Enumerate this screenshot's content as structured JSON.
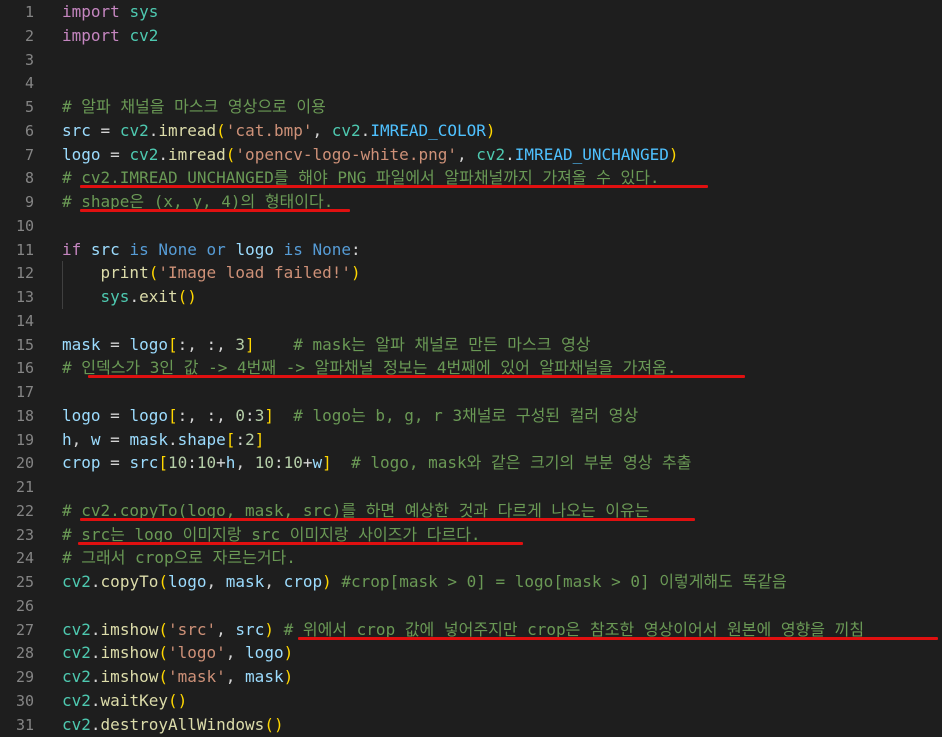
{
  "editor": {
    "language": "python",
    "theme_colors": {
      "background": "#1e1e1e",
      "keyword": "#c586c0",
      "comment": "#6a9955",
      "string": "#ce9178",
      "function": "#dcdcaa",
      "annotation_underline": "#e01010"
    },
    "lines": [
      {
        "n": "1",
        "tokens": [
          {
            "t": "import",
            "c": "kw"
          },
          {
            "t": " "
          },
          {
            "t": "sys",
            "c": "cls"
          }
        ]
      },
      {
        "n": "2",
        "tokens": [
          {
            "t": "import",
            "c": "kw"
          },
          {
            "t": " "
          },
          {
            "t": "cv2",
            "c": "cls"
          }
        ]
      },
      {
        "n": "3",
        "tokens": []
      },
      {
        "n": "4",
        "tokens": []
      },
      {
        "n": "5",
        "tokens": [
          {
            "t": "# 알파 채널을 마스크 영상으로 이용",
            "c": "cmt"
          }
        ]
      },
      {
        "n": "6",
        "tokens": [
          {
            "t": "src",
            "c": "id"
          },
          {
            "t": " = "
          },
          {
            "t": "cv2",
            "c": "cls"
          },
          {
            "t": "."
          },
          {
            "t": "imread",
            "c": "fn"
          },
          {
            "t": "(",
            "c": "p1"
          },
          {
            "t": "'cat.bmp'",
            "c": "str"
          },
          {
            "t": ", "
          },
          {
            "t": "cv2",
            "c": "cls"
          },
          {
            "t": "."
          },
          {
            "t": "IMREAD_COLOR",
            "c": "const"
          },
          {
            "t": ")",
            "c": "p1"
          }
        ]
      },
      {
        "n": "7",
        "tokens": [
          {
            "t": "logo",
            "c": "id"
          },
          {
            "t": " = "
          },
          {
            "t": "cv2",
            "c": "cls"
          },
          {
            "t": "."
          },
          {
            "t": "imread",
            "c": "fn"
          },
          {
            "t": "(",
            "c": "p1"
          },
          {
            "t": "'opencv-logo-white.png'",
            "c": "str"
          },
          {
            "t": ", "
          },
          {
            "t": "cv2",
            "c": "cls"
          },
          {
            "t": "."
          },
          {
            "t": "IMREAD_UNCHANGED",
            "c": "const"
          },
          {
            "t": ")",
            "c": "p1"
          }
        ]
      },
      {
        "n": "8",
        "tokens": [
          {
            "t": "# cv2.IMREAD_UNCHANGED를 해야 PNG 파일에서 알파채널까지 가져올 수 있다.",
            "c": "cmt"
          }
        ]
      },
      {
        "n": "9",
        "tokens": [
          {
            "t": "# shape은 (x, y, 4)의 형태이다.",
            "c": "cmt"
          }
        ]
      },
      {
        "n": "10",
        "tokens": []
      },
      {
        "n": "11",
        "tokens": [
          {
            "t": "if",
            "c": "kw"
          },
          {
            "t": " "
          },
          {
            "t": "src",
            "c": "id"
          },
          {
            "t": " "
          },
          {
            "t": "is",
            "c": "bi"
          },
          {
            "t": " "
          },
          {
            "t": "None",
            "c": "bi"
          },
          {
            "t": " "
          },
          {
            "t": "or",
            "c": "bi"
          },
          {
            "t": " "
          },
          {
            "t": "logo",
            "c": "id"
          },
          {
            "t": " "
          },
          {
            "t": "is",
            "c": "bi"
          },
          {
            "t": " "
          },
          {
            "t": "None",
            "c": "bi"
          },
          {
            "t": ":"
          }
        ]
      },
      {
        "n": "12",
        "indent": true,
        "tokens": [
          {
            "t": "    "
          },
          {
            "t": "print",
            "c": "fn"
          },
          {
            "t": "(",
            "c": "p1"
          },
          {
            "t": "'Image load failed!'",
            "c": "str"
          },
          {
            "t": ")",
            "c": "p1"
          }
        ]
      },
      {
        "n": "13",
        "indent": true,
        "tokens": [
          {
            "t": "    "
          },
          {
            "t": "sys",
            "c": "cls"
          },
          {
            "t": "."
          },
          {
            "t": "exit",
            "c": "fn"
          },
          {
            "t": "()",
            "c": "p1"
          }
        ]
      },
      {
        "n": "14",
        "tokens": []
      },
      {
        "n": "15",
        "tokens": [
          {
            "t": "mask",
            "c": "id"
          },
          {
            "t": " = "
          },
          {
            "t": "logo",
            "c": "id"
          },
          {
            "t": "[",
            "c": "p1"
          },
          {
            "t": ":, :, "
          },
          {
            "t": "3",
            "c": "num"
          },
          {
            "t": "]",
            "c": "p1"
          },
          {
            "t": "    "
          },
          {
            "t": "# mask는 알파 채널로 만든 마스크 영상",
            "c": "cmt"
          }
        ]
      },
      {
        "n": "16",
        "tokens": [
          {
            "t": "# 인덱스가 3인 값 -> 4번째 -> 알파채널 정보는 4번째에 있어 알파채널을 가져옴.",
            "c": "cmt"
          }
        ]
      },
      {
        "n": "17",
        "tokens": []
      },
      {
        "n": "18",
        "tokens": [
          {
            "t": "logo",
            "c": "id"
          },
          {
            "t": " = "
          },
          {
            "t": "logo",
            "c": "id"
          },
          {
            "t": "[",
            "c": "p1"
          },
          {
            "t": ":, :, "
          },
          {
            "t": "0",
            "c": "num"
          },
          {
            "t": ":"
          },
          {
            "t": "3",
            "c": "num"
          },
          {
            "t": "]",
            "c": "p1"
          },
          {
            "t": "  "
          },
          {
            "t": "# logo는 b, g, r 3채널로 구성된 컬러 영상",
            "c": "cmt"
          }
        ]
      },
      {
        "n": "19",
        "tokens": [
          {
            "t": "h",
            "c": "id"
          },
          {
            "t": ", "
          },
          {
            "t": "w",
            "c": "id"
          },
          {
            "t": " = "
          },
          {
            "t": "mask",
            "c": "id"
          },
          {
            "t": "."
          },
          {
            "t": "shape",
            "c": "id"
          },
          {
            "t": "[",
            "c": "p1"
          },
          {
            "t": ":"
          },
          {
            "t": "2",
            "c": "num"
          },
          {
            "t": "]",
            "c": "p1"
          }
        ]
      },
      {
        "n": "20",
        "tokens": [
          {
            "t": "crop",
            "c": "id"
          },
          {
            "t": " = "
          },
          {
            "t": "src",
            "c": "id"
          },
          {
            "t": "[",
            "c": "p1"
          },
          {
            "t": "10",
            "c": "num"
          },
          {
            "t": ":"
          },
          {
            "t": "10",
            "c": "num"
          },
          {
            "t": "+"
          },
          {
            "t": "h",
            "c": "id"
          },
          {
            "t": ", "
          },
          {
            "t": "10",
            "c": "num"
          },
          {
            "t": ":"
          },
          {
            "t": "10",
            "c": "num"
          },
          {
            "t": "+"
          },
          {
            "t": "w",
            "c": "id"
          },
          {
            "t": "]",
            "c": "p1"
          },
          {
            "t": "  "
          },
          {
            "t": "# logo, mask와 같은 크기의 부분 영상 추출",
            "c": "cmt"
          }
        ]
      },
      {
        "n": "21",
        "tokens": []
      },
      {
        "n": "22",
        "tokens": [
          {
            "t": "# cv2.copyTo(logo, mask, src)를 하면 예상한 것과 다르게 나오는 이유는",
            "c": "cmt"
          }
        ]
      },
      {
        "n": "23",
        "tokens": [
          {
            "t": "# src는 logo 이미지랑 src 이미지랑 사이즈가 다르다.",
            "c": "cmt"
          }
        ]
      },
      {
        "n": "24",
        "tokens": [
          {
            "t": "# 그래서 crop으로 자르는거다.",
            "c": "cmt"
          }
        ]
      },
      {
        "n": "25",
        "tokens": [
          {
            "t": "cv2",
            "c": "cls"
          },
          {
            "t": "."
          },
          {
            "t": "copyTo",
            "c": "fn"
          },
          {
            "t": "(",
            "c": "p1"
          },
          {
            "t": "logo",
            "c": "id"
          },
          {
            "t": ", "
          },
          {
            "t": "mask",
            "c": "id"
          },
          {
            "t": ", "
          },
          {
            "t": "crop",
            "c": "id"
          },
          {
            "t": ")",
            "c": "p1"
          },
          {
            "t": " "
          },
          {
            "t": "#crop[mask > 0] = logo[mask > 0] 이렇게해도 똑같음",
            "c": "cmt"
          }
        ]
      },
      {
        "n": "26",
        "tokens": []
      },
      {
        "n": "27",
        "tokens": [
          {
            "t": "cv2",
            "c": "cls"
          },
          {
            "t": "."
          },
          {
            "t": "imshow",
            "c": "fn"
          },
          {
            "t": "(",
            "c": "p1"
          },
          {
            "t": "'src'",
            "c": "str"
          },
          {
            "t": ", "
          },
          {
            "t": "src",
            "c": "id"
          },
          {
            "t": ")",
            "c": "p1"
          },
          {
            "t": " "
          },
          {
            "t": "# 위에서 crop 값에 넣어주지만 crop은 참조한 영상이어서 원본에 영향을 끼침",
            "c": "cmt"
          }
        ]
      },
      {
        "n": "28",
        "tokens": [
          {
            "t": "cv2",
            "c": "cls"
          },
          {
            "t": "."
          },
          {
            "t": "imshow",
            "c": "fn"
          },
          {
            "t": "(",
            "c": "p1"
          },
          {
            "t": "'logo'",
            "c": "str"
          },
          {
            "t": ", "
          },
          {
            "t": "logo",
            "c": "id"
          },
          {
            "t": ")",
            "c": "p1"
          }
        ]
      },
      {
        "n": "29",
        "tokens": [
          {
            "t": "cv2",
            "c": "cls"
          },
          {
            "t": "."
          },
          {
            "t": "imshow",
            "c": "fn"
          },
          {
            "t": "(",
            "c": "p1"
          },
          {
            "t": "'mask'",
            "c": "str"
          },
          {
            "t": ", "
          },
          {
            "t": "mask",
            "c": "id"
          },
          {
            "t": ")",
            "c": "p1"
          }
        ]
      },
      {
        "n": "30",
        "tokens": [
          {
            "t": "cv2",
            "c": "cls"
          },
          {
            "t": "."
          },
          {
            "t": "waitKey",
            "c": "fn"
          },
          {
            "t": "()",
            "c": "p1"
          }
        ]
      },
      {
        "n": "31",
        "tokens": [
          {
            "t": "cv2",
            "c": "cls"
          },
          {
            "t": "."
          },
          {
            "t": "destroyAllWindows",
            "c": "fn"
          },
          {
            "t": "()",
            "c": "p1"
          }
        ]
      }
    ]
  }
}
